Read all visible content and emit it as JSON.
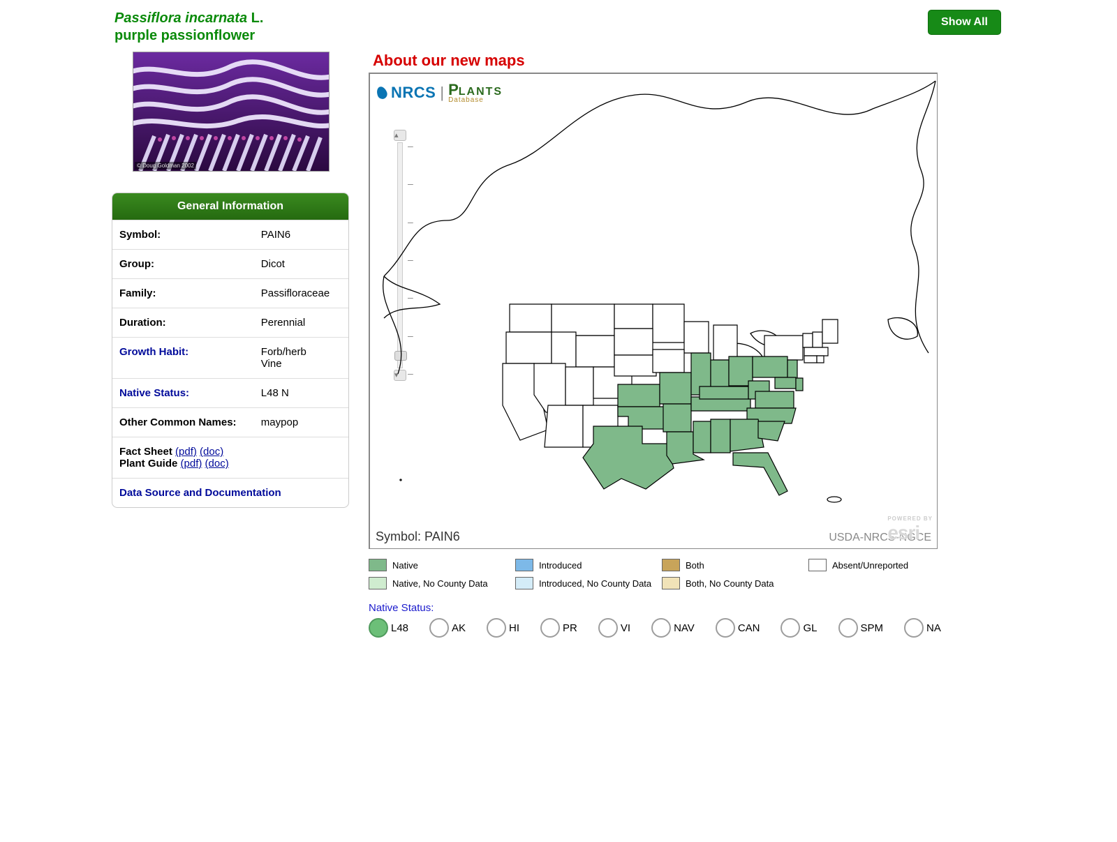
{
  "header": {
    "scientific_name": "Passiflora incarnata",
    "authority": "L.",
    "common_name": "purple passionflower",
    "show_all_label": "Show All"
  },
  "thumbnail": {
    "credit": "© Doug Goldman 2002"
  },
  "info_panel": {
    "title": "General Information",
    "rows": [
      {
        "label": "Symbol:",
        "value": "PAIN6",
        "link": false
      },
      {
        "label": "Group:",
        "value": "Dicot",
        "link": false
      },
      {
        "label": "Family:",
        "value": "Passifloraceae",
        "link": false
      },
      {
        "label": "Duration:",
        "value": "Perennial",
        "link": false
      },
      {
        "label": "Growth Habit:",
        "value": "Forb/herb\nVine",
        "link": true
      },
      {
        "label": "Native Status:",
        "value": "L48   N",
        "link": true
      },
      {
        "label": "Other Common Names:",
        "value": "maypop",
        "link": false
      }
    ],
    "docs": {
      "fact_sheet_label": "Fact Sheet",
      "plant_guide_label": "Plant Guide",
      "pdf_label": "(pdf)",
      "doc_label": "(doc)"
    },
    "datasource_label": "Data Source and Documentation"
  },
  "map": {
    "about_heading": "About our new maps",
    "logo": {
      "nrcs": "NRCS",
      "plants": "PLANTS",
      "db": "Database"
    },
    "symbol_label": "Symbol:",
    "symbol_value": "PAIN6",
    "attribution": "USDA-NRCS-NGCE",
    "esri_powered": "POWERED BY",
    "esri": "esri",
    "native_states": [
      "TX",
      "OK",
      "KS",
      "MO",
      "AR",
      "LA",
      "MS",
      "AL",
      "GA",
      "FL",
      "SC",
      "NC",
      "TN",
      "KY",
      "IL",
      "IN",
      "OH",
      "WV",
      "VA",
      "MD",
      "DE",
      "PA",
      "NJ"
    ]
  },
  "legend": [
    {
      "swatch": "native",
      "label": "Native"
    },
    {
      "swatch": "intro",
      "label": "Introduced"
    },
    {
      "swatch": "both",
      "label": "Both"
    },
    {
      "swatch": "absent",
      "label": "Absent/Unreported"
    },
    {
      "swatch": "native-nc",
      "label": "Native, No County Data"
    },
    {
      "swatch": "intro-nc",
      "label": "Introduced, No County Data"
    },
    {
      "swatch": "both-nc",
      "label": "Both, No County Data"
    }
  ],
  "native_status": {
    "label": "Native Status:",
    "options": [
      {
        "code": "L48",
        "selected": true
      },
      {
        "code": "AK",
        "selected": false
      },
      {
        "code": "HI",
        "selected": false
      },
      {
        "code": "PR",
        "selected": false
      },
      {
        "code": "VI",
        "selected": false
      },
      {
        "code": "NAV",
        "selected": false
      },
      {
        "code": "CAN",
        "selected": false
      },
      {
        "code": "GL",
        "selected": false
      },
      {
        "code": "SPM",
        "selected": false
      },
      {
        "code": "NA",
        "selected": false
      }
    ]
  }
}
